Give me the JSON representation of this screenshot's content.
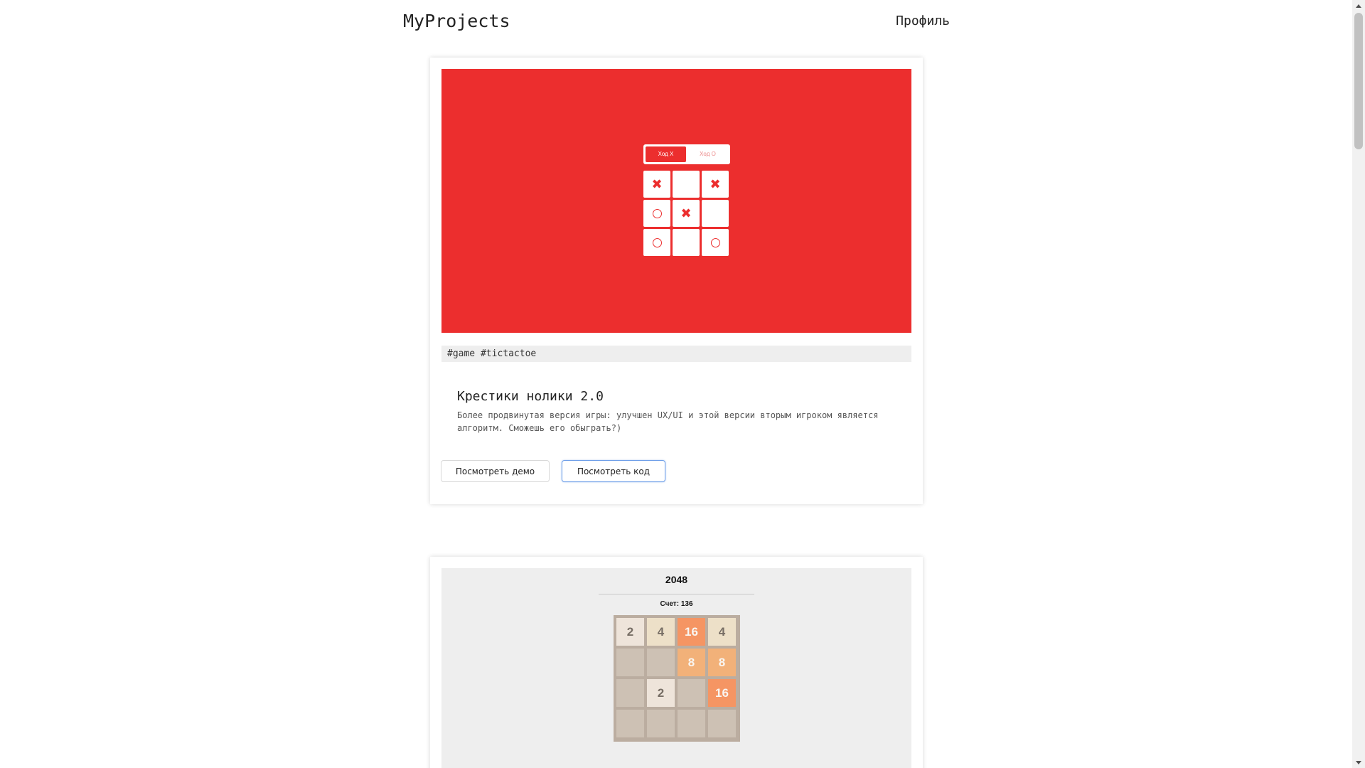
{
  "header": {
    "brand": "MyProjects",
    "profile_label": "Профиль"
  },
  "projects": [
    {
      "preview": {
        "turn_x_label": "Ход X",
        "turn_o_label": "Ход O",
        "board": [
          "X",
          "",
          "X",
          "O",
          "X",
          "",
          "O",
          "",
          "O"
        ],
        "accent_color": "#ec2e2e"
      },
      "tags": "#game #tictactoe",
      "title": "Крестики нолики 2.0",
      "description": "Более продвинутая версия игры: улучшен UX/UI и этой версии вторым игроком является алгоритм. Сможешь его обыграть?)",
      "demo_label": "Посмотреть демо",
      "code_label": "Посмотреть код"
    },
    {
      "preview": {
        "game_title": "2048",
        "score_text": "Счет: 136",
        "board": [
          2,
          4,
          16,
          4,
          0,
          0,
          8,
          8,
          0,
          2,
          0,
          16,
          0,
          0,
          0,
          0
        ]
      }
    }
  ]
}
